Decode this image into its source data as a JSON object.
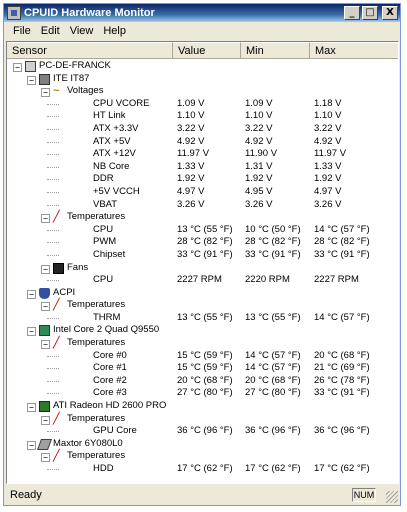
{
  "window": {
    "title": "CPUID Hardware Monitor",
    "minimize": "_",
    "maximize": "□",
    "close": "X"
  },
  "menu": [
    "File",
    "Edit",
    "View",
    "Help"
  ],
  "columns": {
    "sensor": "Sensor",
    "value": "Value",
    "min": "Min",
    "max": "Max"
  },
  "tree": [
    {
      "level": 0,
      "expander": "−",
      "icon": "computer-icon",
      "label": "PC-DE-FRANCK"
    },
    {
      "level": 1,
      "expander": "−",
      "icon": "chip-icon",
      "label": "ITE IT87"
    },
    {
      "level": 2,
      "expander": "−",
      "icon": "voltage-icon",
      "label": "Voltages"
    },
    {
      "level": 3,
      "label": "CPU VCORE",
      "value": "1.09 V",
      "min": "1.09 V",
      "max": "1.18 V"
    },
    {
      "level": 3,
      "label": "HT Link",
      "value": "1.10 V",
      "min": "1.10 V",
      "max": "1.10 V"
    },
    {
      "level": 3,
      "label": "ATX +3.3V",
      "value": "3.22 V",
      "min": "3.22 V",
      "max": "3.22 V"
    },
    {
      "level": 3,
      "label": "ATX +5V",
      "value": "4.92 V",
      "min": "4.92 V",
      "max": "4.92 V"
    },
    {
      "level": 3,
      "label": "ATX +12V",
      "value": "11.97 V",
      "min": "11.90 V",
      "max": "11.97 V"
    },
    {
      "level": 3,
      "label": "NB Core",
      "value": "1.33 V",
      "min": "1.31 V",
      "max": "1.33 V"
    },
    {
      "level": 3,
      "label": "DDR",
      "value": "1.92 V",
      "min": "1.92 V",
      "max": "1.92 V"
    },
    {
      "level": 3,
      "label": "+5V VCCH",
      "value": "4.97 V",
      "min": "4.95 V",
      "max": "4.97 V"
    },
    {
      "level": 3,
      "label": "VBAT",
      "value": "3.26 V",
      "min": "3.26 V",
      "max": "3.26 V"
    },
    {
      "level": 2,
      "expander": "−",
      "icon": "thermometer-icon",
      "label": "Temperatures"
    },
    {
      "level": 3,
      "label": "CPU",
      "value": "13 °C  (55 °F)",
      "min": "10 °C  (50 °F)",
      "max": "14 °C  (57 °F)"
    },
    {
      "level": 3,
      "label": "PWM",
      "value": "28 °C  (82 °F)",
      "min": "28 °C  (82 °F)",
      "max": "28 °C  (82 °F)"
    },
    {
      "level": 3,
      "label": "Chipset",
      "value": "33 °C  (91 °F)",
      "min": "33 °C  (91 °F)",
      "max": "33 °C  (91 °F)"
    },
    {
      "level": 2,
      "expander": "−",
      "icon": "fan-icon",
      "label": "Fans"
    },
    {
      "level": 3,
      "label": "CPU",
      "value": "2227 RPM",
      "min": "2220 RPM",
      "max": "2227 RPM"
    },
    {
      "level": 1,
      "expander": "−",
      "icon": "acpi-icon",
      "label": "ACPI"
    },
    {
      "level": 2,
      "expander": "−",
      "icon": "thermometer-icon",
      "label": "Temperatures"
    },
    {
      "level": 3,
      "label": "THRM",
      "value": "13 °C  (55 °F)",
      "min": "13 °C  (55 °F)",
      "max": "14 °C  (57 °F)"
    },
    {
      "level": 1,
      "expander": "−",
      "icon": "cpu-icon",
      "label": "Intel Core 2 Quad Q9550"
    },
    {
      "level": 2,
      "expander": "−",
      "icon": "thermometer-icon",
      "label": "Temperatures"
    },
    {
      "level": 3,
      "label": "Core #0",
      "value": "15 °C  (59 °F)",
      "min": "14 °C  (57 °F)",
      "max": "20 °C  (68 °F)"
    },
    {
      "level": 3,
      "label": "Core #1",
      "value": "15 °C  (59 °F)",
      "min": "14 °C  (57 °F)",
      "max": "21 °C  (69 °F)"
    },
    {
      "level": 3,
      "label": "Core #2",
      "value": "20 °C  (68 °F)",
      "min": "20 °C  (68 °F)",
      "max": "26 °C  (78 °F)"
    },
    {
      "level": 3,
      "label": "Core #3",
      "value": "27 °C  (80 °F)",
      "min": "27 °C  (80 °F)",
      "max": "33 °C  (91 °F)"
    },
    {
      "level": 1,
      "expander": "−",
      "icon": "gpu-icon",
      "label": "ATI Radeon HD 2600 PRO"
    },
    {
      "level": 2,
      "expander": "−",
      "icon": "thermometer-icon",
      "label": "Temperatures"
    },
    {
      "level": 3,
      "label": "GPU Core",
      "value": "36 °C  (96 °F)",
      "min": "36 °C  (96 °F)",
      "max": "36 °C  (96 °F)"
    },
    {
      "level": 1,
      "expander": "−",
      "icon": "hdd-icon",
      "label": "Maxtor 6Y080L0"
    },
    {
      "level": 2,
      "expander": "−",
      "icon": "thermometer-icon",
      "label": "Temperatures"
    },
    {
      "level": 3,
      "label": "HDD",
      "value": "17 °C  (62 °F)",
      "min": "17 °C  (62 °F)",
      "max": "17 °C  (62 °F)"
    }
  ],
  "status": {
    "text": "Ready",
    "num": "NUM"
  }
}
